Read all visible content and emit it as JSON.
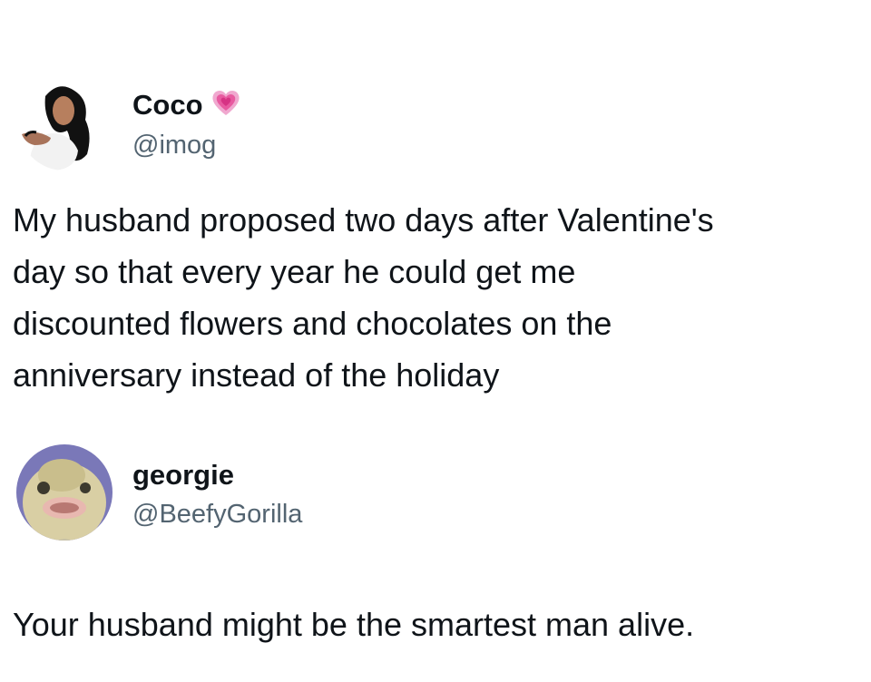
{
  "tweets": [
    {
      "display_name": "Coco",
      "name_badge_icon": "growing-heart-emoji",
      "handle": "@imog",
      "avatar_icon": "profile-photo-woman",
      "lines": [
        "My husband proposed two days after Valentine's",
        "day so that every year he could get me",
        "discounted flowers and chocolates on the",
        "anniversary instead of the holiday"
      ]
    },
    {
      "display_name": "georgie",
      "handle": "@BeefyGorilla",
      "avatar_icon": "profile-photo-fish",
      "lines": [
        "Your husband might be the smartest man alive."
      ]
    }
  ],
  "colors": {
    "text": "#0f1419",
    "handle": "#536471",
    "heart": "#e85aa0",
    "background": "#ffffff"
  }
}
